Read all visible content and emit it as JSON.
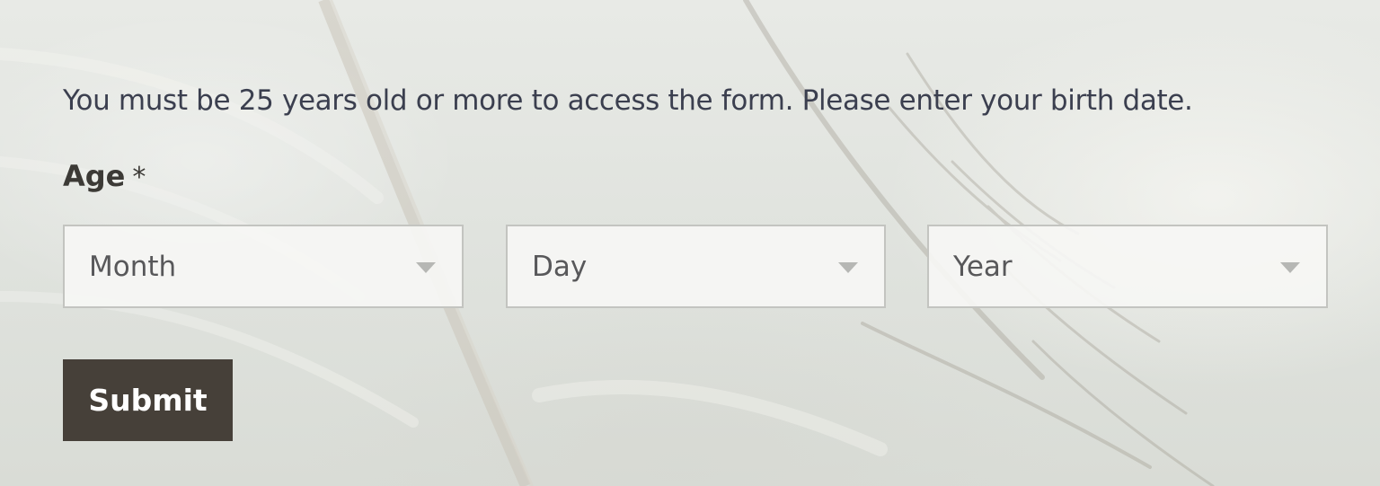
{
  "form": {
    "notice": "You must be 25 years old or more to access the form. Please enter your birth date.",
    "field": {
      "label": "Age",
      "required_marker": "*"
    },
    "selects": {
      "month": {
        "value": "Month",
        "icon": "chevron-down-icon"
      },
      "day": {
        "value": "Day",
        "icon": "chevron-down-icon"
      },
      "year": {
        "value": "Year",
        "icon": "chevron-down-icon"
      }
    },
    "submit_label": "Submit"
  },
  "colors": {
    "button_bg": "#464039",
    "text_primary": "#3b3f4f",
    "select_bg": "#f6f6f4"
  }
}
